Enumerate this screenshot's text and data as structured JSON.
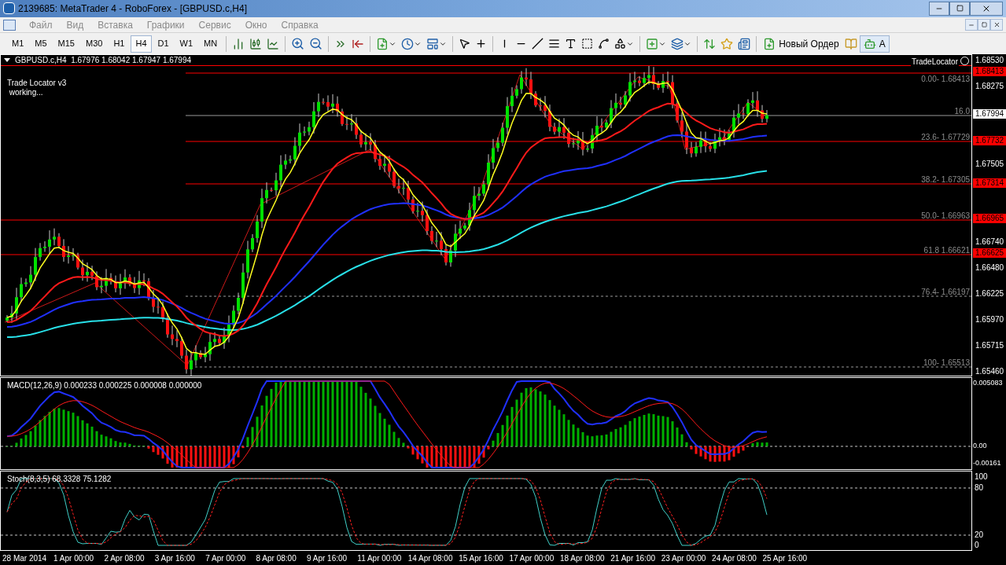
{
  "window": {
    "title": "2139685: MetaTrader 4 - RoboForex - [GBPUSD.c,H4]"
  },
  "menu": [
    "Файл",
    "Вид",
    "Вставка",
    "Графики",
    "Сервис",
    "Окно",
    "Справка"
  ],
  "timeframes": [
    {
      "label": "M1",
      "selected": false
    },
    {
      "label": "M5",
      "selected": false
    },
    {
      "label": "M15",
      "selected": false
    },
    {
      "label": "M30",
      "selected": false
    },
    {
      "label": "H1",
      "selected": false
    },
    {
      "label": "H4",
      "selected": true
    },
    {
      "label": "D1",
      "selected": false
    },
    {
      "label": "W1",
      "selected": false
    },
    {
      "label": "MN",
      "selected": false
    }
  ],
  "toolbar": {
    "new_order": "Новый Ордер",
    "autotrading": "A"
  },
  "chart": {
    "header": "GBPUSD.c,H4  1.67976 1.68042 1.67947 1.67994",
    "indicator_lines": [
      "Trade Locator v3",
      " working..."
    ],
    "tradelocator": "TradeLocator",
    "fib_levels": [
      {
        "label": "0.00- 1.68413",
        "kind": "red"
      },
      {
        "label": "16.0",
        "kind": "grey"
      },
      {
        "label": "23.6- 1.67729",
        "kind": "red"
      },
      {
        "label": "38.2- 1.67305",
        "kind": "red"
      },
      {
        "label": "50.0- 1.66963",
        "kind": "red"
      },
      {
        "label": "61.8 1.66621",
        "kind": "red"
      },
      {
        "label": "76.4- 1.66197",
        "kind": "dashed"
      },
      {
        "label": "100- 1.65513",
        "kind": "dashed"
      }
    ],
    "price_axis": [
      "1.68530",
      "1.68275",
      "1.67505",
      "1.66740",
      "1.66480",
      "1.66225",
      "1.65970",
      "1.65715",
      "1.65460"
    ],
    "price_markers": [
      {
        "text": "1.68413",
        "kind": "level"
      },
      {
        "text": "1.67994",
        "kind": "bid"
      },
      {
        "text": "1.67732",
        "kind": "level"
      },
      {
        "text": "1.67314",
        "kind": "level"
      },
      {
        "text": "1.66965",
        "kind": "level"
      },
      {
        "text": "1.66625",
        "kind": "level"
      }
    ]
  },
  "macd": {
    "header": "MACD(12,26,9) 0.000233 0.000225 0.000008 0.000000",
    "axis": [
      "0.005083",
      "0.00",
      "-0.00161"
    ]
  },
  "stoch": {
    "header": "Stoch(8,3,5) 68.3328 75.1282",
    "axis": [
      "100",
      "80",
      "20",
      "0"
    ]
  },
  "time_axis": [
    "28 Mar 2014",
    "1 Apr 00:00",
    "2 Apr 08:00",
    "3 Apr 16:00",
    "7 Apr 00:00",
    "8 Apr 08:00",
    "9 Apr 16:00",
    "11 Apr 00:00",
    "14 Apr 08:00",
    "15 Apr 16:00",
    "17 Apr 00:00",
    "18 Apr 08:00",
    "21 Apr 16:00",
    "23 Apr 00:00",
    "24 Apr 08:00",
    "25 Apr 16:00"
  ]
}
